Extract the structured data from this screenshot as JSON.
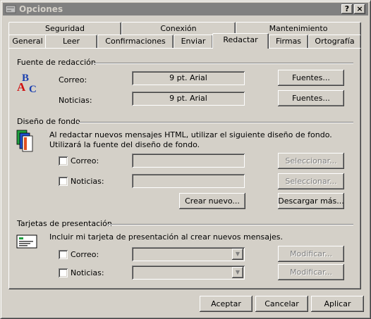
{
  "window": {
    "title": "Opciones",
    "help_btn": "?",
    "close_btn": "×"
  },
  "tabs_back": [
    "Seguridad",
    "Conexión",
    "Mantenimiento"
  ],
  "tabs_front": [
    "General",
    "Leer",
    "Confirmaciones",
    "Enviar",
    "Redactar",
    "Firmas",
    "Ortografía"
  ],
  "compose_font": {
    "title": "Fuente de redacción",
    "mail_label": "Correo:",
    "mail_value": "9 pt. Arial",
    "news_label": "Noticias:",
    "news_value": "9 pt. Arial",
    "fonts_button": "Fuentes..."
  },
  "stationery": {
    "title": "Diseño de fondo",
    "desc1": "Al redactar nuevos mensajes HTML, utilizar el siguiente diseño de fondo.",
    "desc2": "Utilizará la fuente del diseño de fondo.",
    "mail_label": "Correo:",
    "news_label": "Noticias:",
    "select_button": "Seleccionar...",
    "create_button": "Crear nuevo...",
    "download_button": "Descargar más..."
  },
  "business_cards": {
    "title": "Tarjetas de presentación",
    "desc": "Incluir mi tarjeta de presentación al crear nuevos mensajes.",
    "mail_label": "Correo:",
    "news_label": "Noticias:",
    "modify_button": "Modificar..."
  },
  "footer": {
    "ok": "Aceptar",
    "cancel": "Cancelar",
    "apply": "Aplicar"
  }
}
